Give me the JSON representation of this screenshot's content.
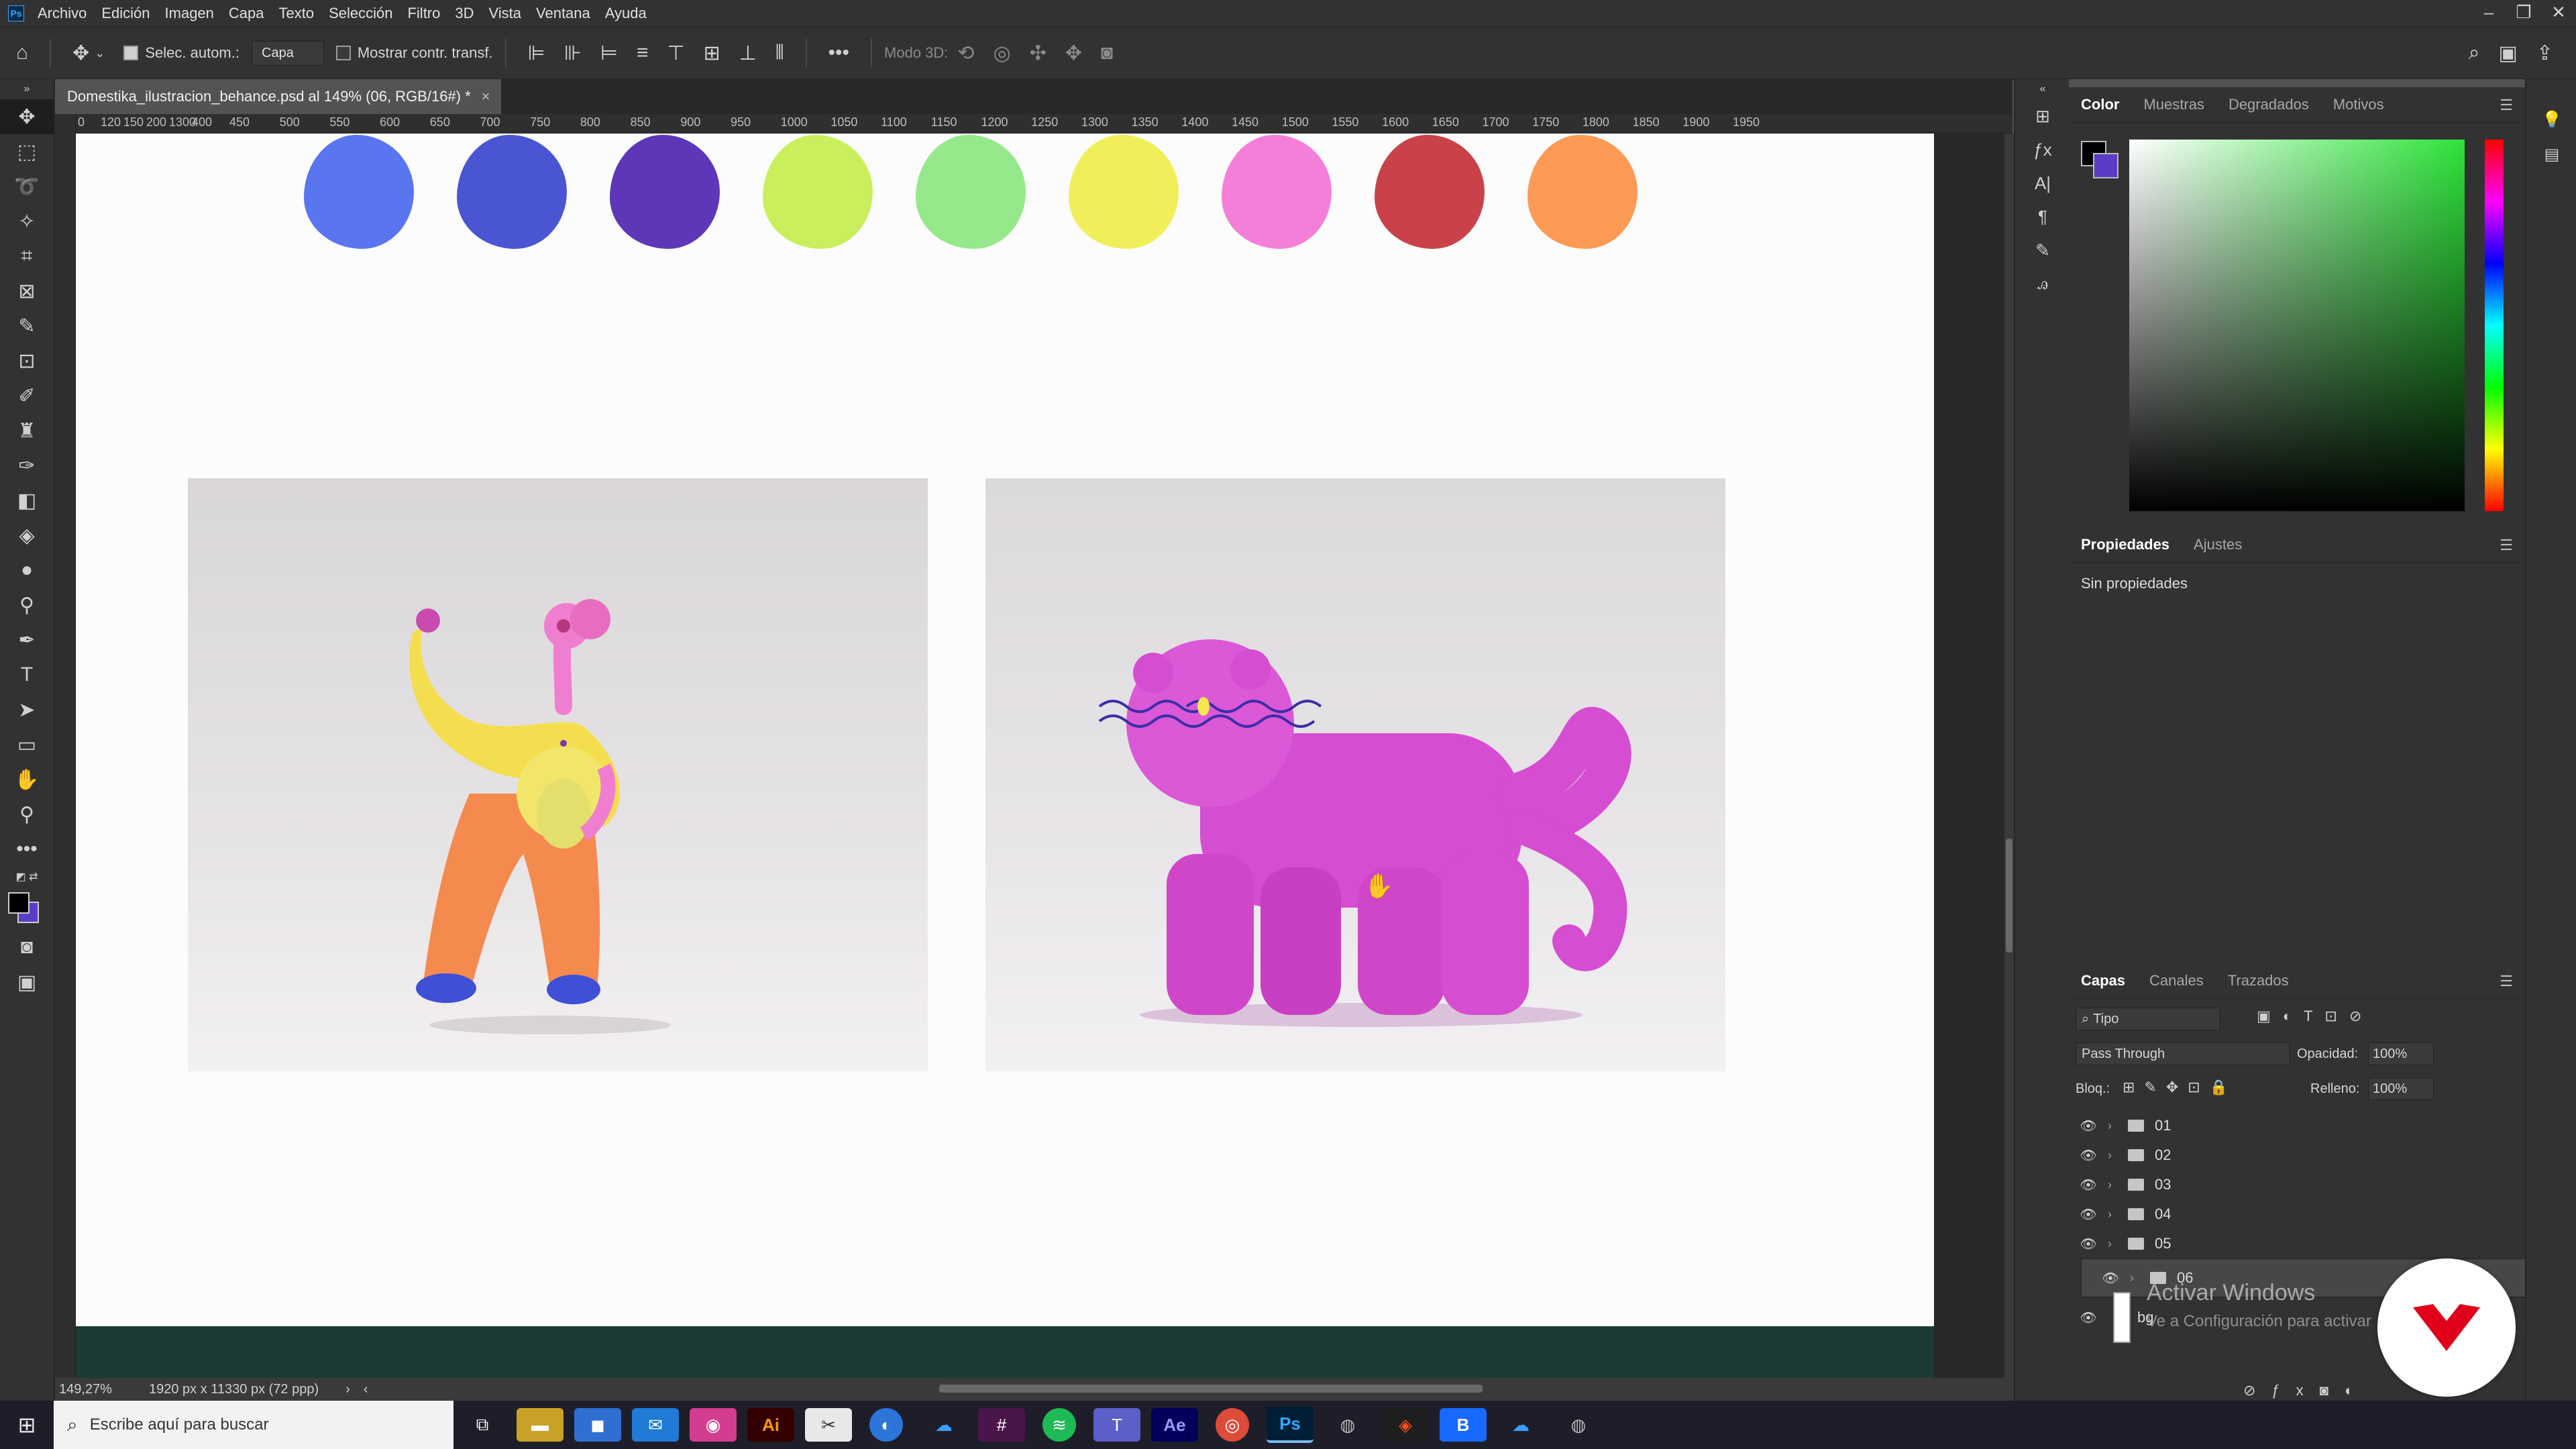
{
  "menubar": {
    "items": [
      "Archivo",
      "Edición",
      "Imagen",
      "Capa",
      "Texto",
      "Selección",
      "Filtro",
      "3D",
      "Vista",
      "Ventana",
      "Ayuda"
    ]
  },
  "options": {
    "auto_select_label": "Selec. autom.:",
    "auto_select_value": "Capa",
    "show_transform_label": "Mostrar contr. transf.",
    "mode_3d_label": "Modo 3D:"
  },
  "document": {
    "tab_title": "Domestika_ilustracion_behance.psd al 149% (06, RGB/16#) *",
    "zoom": "149,27%",
    "doc_size": "1920 px x 11330 px (72 ppp)"
  },
  "ruler": {
    "labels": [
      "0",
      "120",
      "150",
      "200",
      "1300",
      "400",
      "450",
      "500",
      "550",
      "600",
      "650",
      "700",
      "750",
      "800",
      "850",
      "900",
      "950",
      "1000",
      "1050",
      "1100",
      "1150",
      "1200",
      "1250",
      "1300",
      "1350",
      "1400",
      "1450",
      "1500",
      "1550",
      "1600",
      "1650",
      "1700",
      "1750",
      "1800",
      "1850",
      "1900",
      "1950"
    ]
  },
  "swatches": [
    "#5a75f0",
    "#4a55d2",
    "#5d37b8",
    "#c9ef5d",
    "#95e98a",
    "#f0ef5a",
    "#f47fd8",
    "#c9424a",
    "#fd9a55"
  ],
  "panels": {
    "color_tabs": [
      "Color",
      "Muestras",
      "Degradados",
      "Motivos"
    ],
    "properties_tabs": [
      "Propiedades",
      "Ajustes"
    ],
    "properties_empty": "Sin propiedades",
    "layers_tabs": [
      "Capas",
      "Canales",
      "Trazados"
    ],
    "filter_type": "Tipo",
    "blend_mode": "Pass Through",
    "opacity_label": "Opacidad:",
    "opacity_value": "100%",
    "lock_label": "Bloq.:",
    "fill_label": "Relleno:",
    "fill_value": "100%",
    "layers": [
      "01",
      "02",
      "03",
      "04",
      "05",
      "06"
    ],
    "bg_layer": "bg"
  },
  "watermark": {
    "title": "Activar Windows",
    "subtitle": "Ve a Configuración para activar"
  },
  "taskbar": {
    "search_placeholder": "Escribe aquí para buscar"
  },
  "colors": {
    "foreground": "#000000",
    "background": "#5b3cc4",
    "accent": "#31a8ff"
  }
}
